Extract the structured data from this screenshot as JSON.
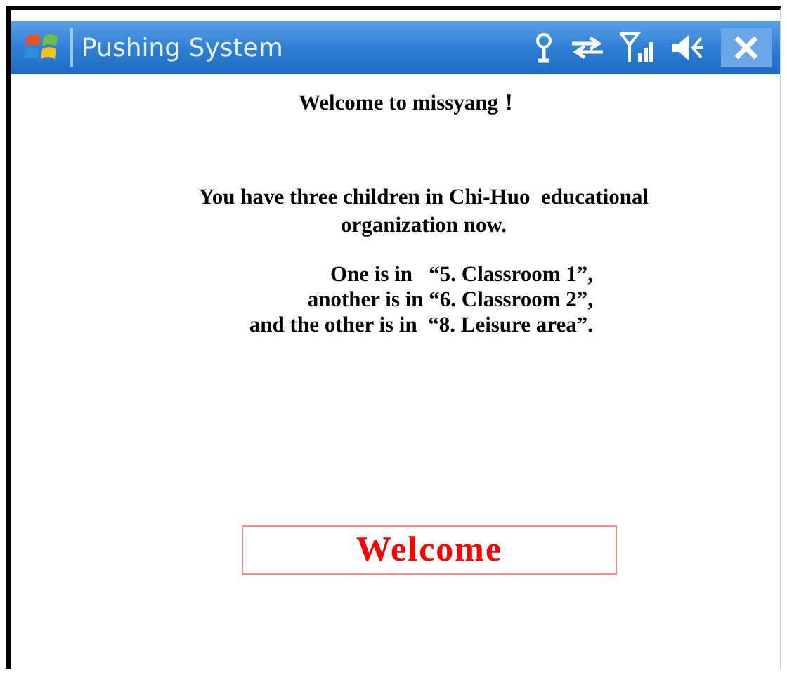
{
  "window": {
    "title": "Pushing System"
  },
  "greeting": "Welcome to missyang！",
  "intro": [
    "You have three children in Chi-Huo  educational",
    "organization now."
  ],
  "locations": [
    "One is in   “5. Classroom 1”,",
    "another is in “6. Classroom 2”,",
    "and the other is in  “8. Leisure area”."
  ],
  "welcome_button": "Welcome"
}
